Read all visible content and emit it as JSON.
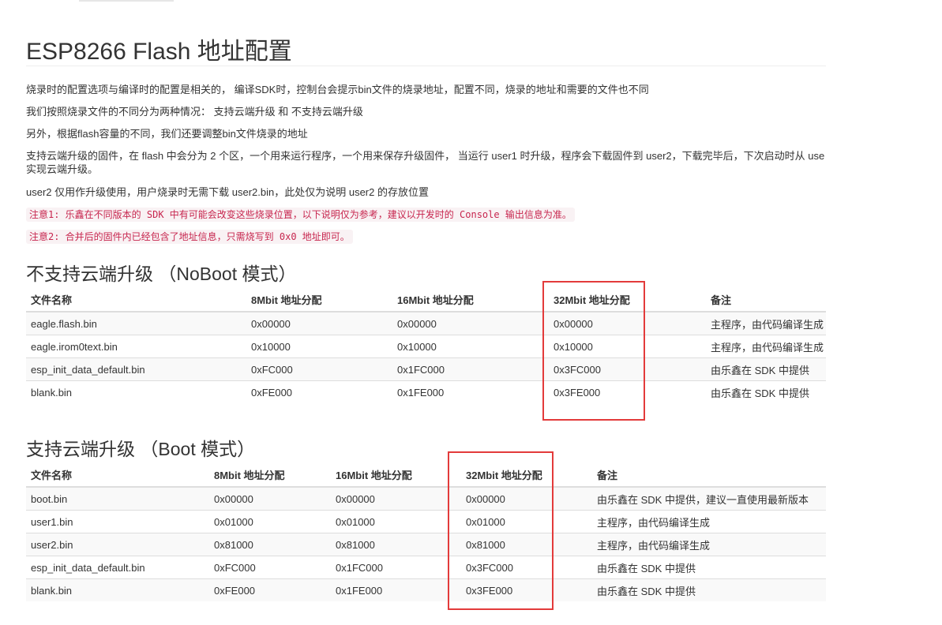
{
  "title": "ESP8266 Flash 地址配置",
  "paragraphs": [
    "烧录时的配置选项与编译时的配置是相关的， 编译SDK时，控制台会提示bin文件的烧录地址，配置不同，烧录的地址和需要的文件也不同",
    "我们按照烧录文件的不同分为两种情况： 支持云端升级 和 不支持云端升级",
    "另外，根据flash容量的不同，我们还要调整bin文件烧录的地址",
    "支持云端升级的固件，在 flash 中会分为 2 个区，一个用来运行程序，一个用来保存升级固件， 当运行 user1 时升级，程序会下载固件到 user2，下载完毕后，下次启动时从 use",
    "实现云端升级。",
    "user2 仅用作升级使用，用户烧录时无需下载 user2.bin，此处仅为说明 user2 的存放位置"
  ],
  "notes": [
    "注意1: 乐鑫在不同版本的 SDK 中有可能会改变这些烧录位置，以下说明仅为参考，建议以开发时的 Console 输出信息为准。",
    "注意2: 合并后的固件内已经包含了地址信息，只需烧写到 0x0 地址即可。"
  ],
  "noboot": {
    "heading": "不支持云端升级 （NoBoot 模式）",
    "columns": [
      "文件名称",
      "8Mbit 地址分配",
      "16Mbit 地址分配",
      "32Mbit 地址分配",
      "备注"
    ],
    "rows": [
      [
        "eagle.flash.bin",
        "0x00000",
        "0x00000",
        "0x00000",
        "主程序，由代码编译生成"
      ],
      [
        "eagle.irom0text.bin",
        "0x10000",
        "0x10000",
        "0x10000",
        "主程序，由代码编译生成"
      ],
      [
        "esp_init_data_default.bin",
        "0xFC000",
        "0x1FC000",
        "0x3FC000",
        "由乐鑫在 SDK 中提供"
      ],
      [
        "blank.bin",
        "0xFE000",
        "0x1FE000",
        "0x3FE000",
        "由乐鑫在 SDK 中提供"
      ]
    ]
  },
  "boot": {
    "heading": "支持云端升级 （Boot 模式）",
    "columns": [
      "文件名称",
      "8Mbit 地址分配",
      "16Mbit 地址分配",
      "32Mbit 地址分配",
      "备注"
    ],
    "rows": [
      [
        "boot.bin",
        "0x00000",
        "0x00000",
        "0x00000",
        "由乐鑫在 SDK 中提供，建议一直使用最新版本"
      ],
      [
        "user1.bin",
        "0x01000",
        "0x01000",
        "0x01000",
        "主程序，由代码编译生成"
      ],
      [
        "user2.bin",
        "0x81000",
        "0x81000",
        "0x81000",
        "主程序，由代码编译生成"
      ],
      [
        "esp_init_data_default.bin",
        "0xFC000",
        "0x1FC000",
        "0x3FC000",
        "由乐鑫在 SDK 中提供"
      ],
      [
        "blank.bin",
        "0xFE000",
        "0x1FE000",
        "0x3FE000",
        "由乐鑫在 SDK 中提供"
      ]
    ]
  },
  "highlight_color": "#e33b3b"
}
